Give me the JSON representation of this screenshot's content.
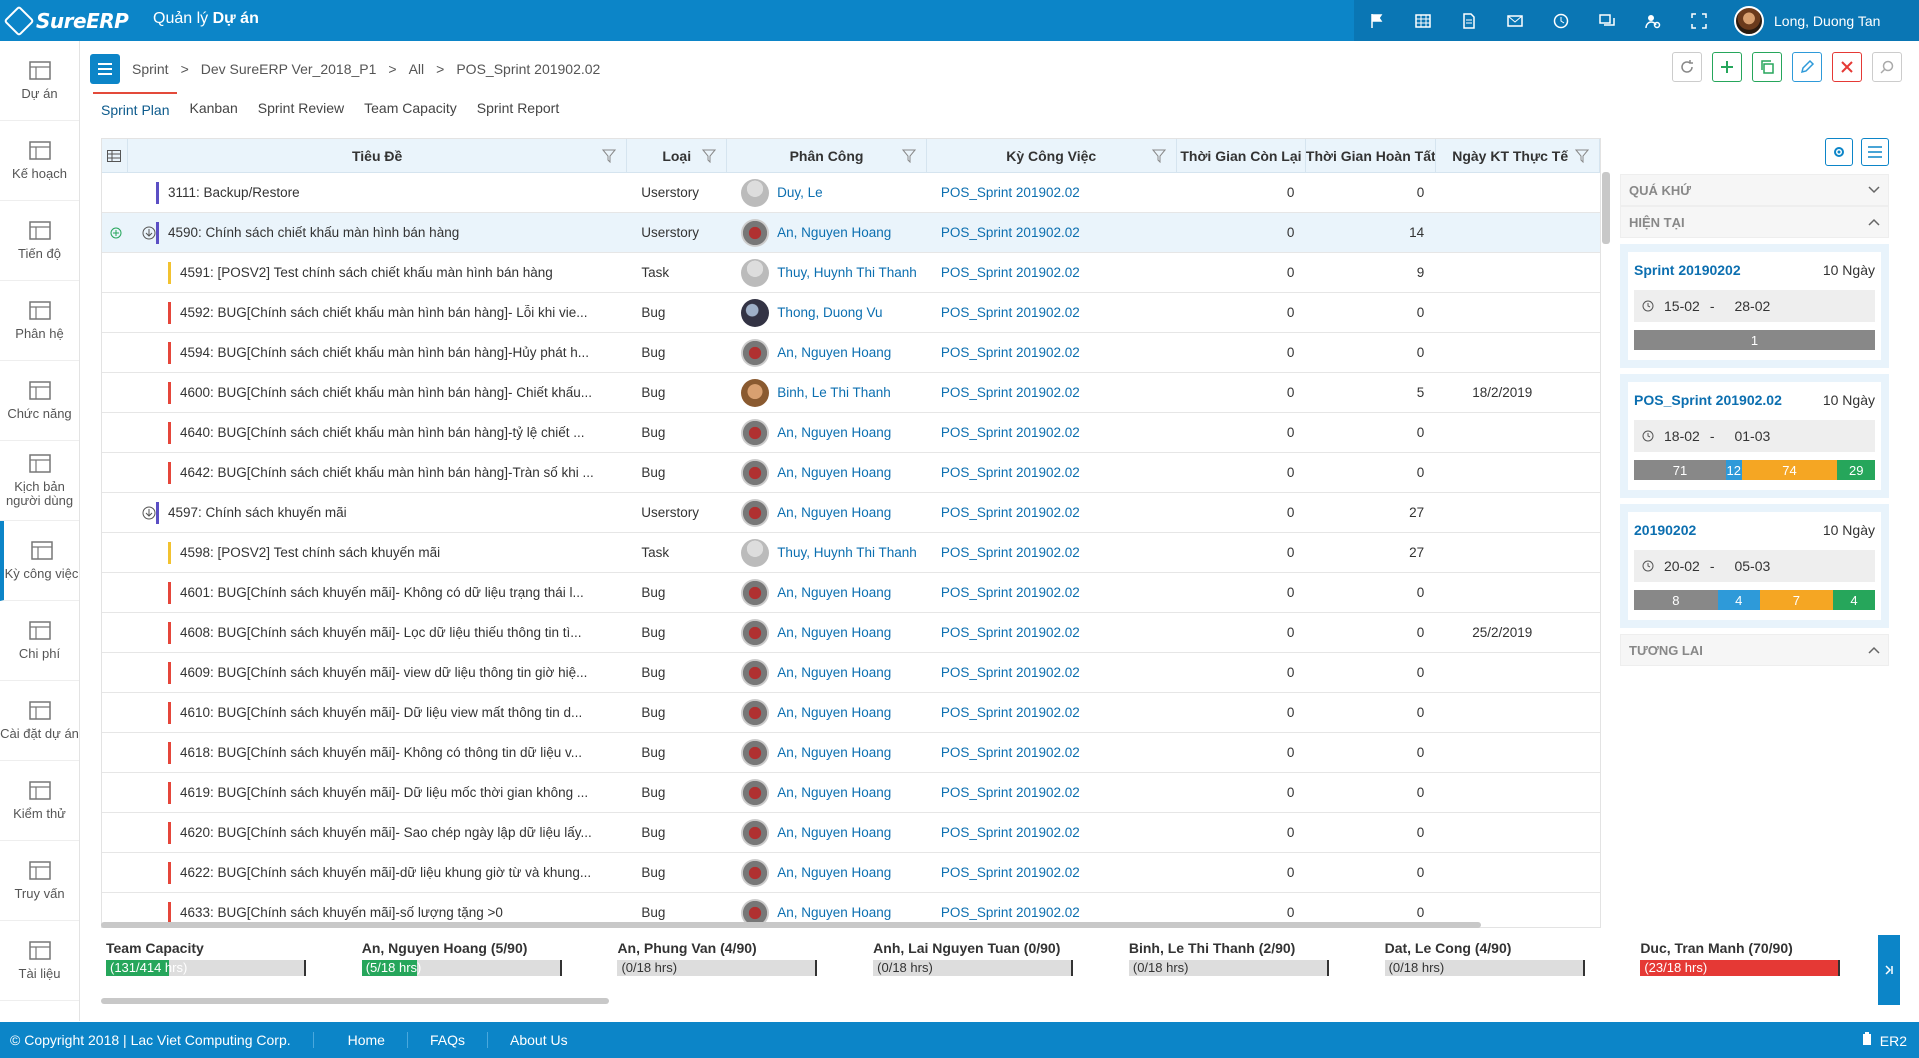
{
  "app": {
    "logo": "SureERP",
    "module": "Quản lý",
    "module_bold": "Dự án"
  },
  "topbar": {
    "icons": [
      "flag-icon",
      "table-icon",
      "document-icon",
      "mail-icon",
      "clock-icon",
      "chat-icon",
      "settings-person-icon",
      "fullscreen-icon"
    ],
    "user_name": "Long, Duong Tan"
  },
  "sidebar": {
    "items": [
      {
        "label": "Dự án",
        "icon": "project-icon"
      },
      {
        "label": "Kế hoạch",
        "icon": "plan-icon"
      },
      {
        "label": "Tiến độ",
        "icon": "progress-icon"
      },
      {
        "label": "Phân hệ",
        "icon": "module-icon"
      },
      {
        "label": "Chức năng",
        "icon": "function-icon"
      },
      {
        "label": "Kịch bản người dùng",
        "icon": "scenario-icon"
      },
      {
        "label": "Kỳ công việc",
        "icon": "sprint-icon",
        "active": true
      },
      {
        "label": "Chi phí",
        "icon": "cost-icon"
      },
      {
        "label": "Cài đặt dự án",
        "icon": "project-settings-icon"
      },
      {
        "label": "Kiểm thử",
        "icon": "test-icon"
      },
      {
        "label": "Truy vấn",
        "icon": "query-icon"
      },
      {
        "label": "Tài liệu",
        "icon": "docs-icon"
      }
    ]
  },
  "breadcrumb": {
    "items": [
      "Sprint",
      "Dev SureERP Ver_2018_P1",
      "All",
      "POS_Sprint 201902.02"
    ],
    "sep": ">"
  },
  "tabs": [
    "Sprint Plan",
    "Kanban",
    "Sprint Review",
    "Team Capacity",
    "Sprint Report"
  ],
  "grid": {
    "headers": {
      "title": "Tiêu Đề",
      "type": "Loại",
      "assignee": "Phân Công",
      "sprint": "Kỳ Công Việc",
      "remaining": "Thời Gian Còn Lại",
      "done": "Thời Gian Hoàn Tất",
      "end_date": "Ngày KT Thực Tế"
    },
    "rows": [
      {
        "title": "3111: Backup/Restore",
        "type": "Userstory",
        "assignee": "Duy, Le",
        "sprint": "POS_Sprint 201902.02",
        "remaining": "0",
        "done": "0",
        "end_date": "",
        "level": 0,
        "color": "#5b4fc4",
        "av": "grey"
      },
      {
        "title": "4590: Chính sách chiết khấu màn hình bán hàng",
        "type": "Userstory",
        "assignee": "An, Nguyen Hoang",
        "sprint": "POS_Sprint 201902.02",
        "remaining": "0",
        "done": "14",
        "end_date": "",
        "level": 0,
        "color": "#5b4fc4",
        "av": "logo",
        "expand": true,
        "selected": true
      },
      {
        "title": "4591: [POSV2] Test chính sách chiết khấu màn hình bán hàng",
        "type": "Task",
        "assignee": "Thuy, Huynh Thi Thanh",
        "sprint": "POS_Sprint 201902.02",
        "remaining": "0",
        "done": "9",
        "end_date": "",
        "level": 1,
        "color": "#f2c230",
        "av": "grey"
      },
      {
        "title": "4592: BUG[Chính sách chiết khấu màn hình bán hàng]- Lỗi khi vie...",
        "type": "Bug",
        "assignee": "Thong, Duong Vu",
        "sprint": "POS_Sprint 201902.02",
        "remaining": "0",
        "done": "0",
        "end_date": "",
        "level": 1,
        "color": "#e5463a",
        "av": "dark"
      },
      {
        "title": "4594: BUG[Chính sách chiết khấu màn hình bán hàng]-Hủy phát h...",
        "type": "Bug",
        "assignee": "An, Nguyen Hoang",
        "sprint": "POS_Sprint 201902.02",
        "remaining": "0",
        "done": "0",
        "end_date": "",
        "level": 1,
        "color": "#e5463a",
        "av": "logo"
      },
      {
        "title": "4600: BUG[Chính sách chiết khấu màn hình bán hàng]- Chiết khấu...",
        "type": "Bug",
        "assignee": "Binh, Le Thi Thanh",
        "sprint": "POS_Sprint 201902.02",
        "remaining": "0",
        "done": "5",
        "end_date": "18/2/2019",
        "level": 1,
        "color": "#e5463a",
        "av": "cat"
      },
      {
        "title": "4640: BUG[Chính sách chiết khấu màn hình bán hàng]-tỷ lệ chiết ...",
        "type": "Bug",
        "assignee": "An, Nguyen Hoang",
        "sprint": "POS_Sprint 201902.02",
        "remaining": "0",
        "done": "0",
        "end_date": "",
        "level": 1,
        "color": "#e5463a",
        "av": "logo"
      },
      {
        "title": "4642: BUG[Chính sách chiết khấu màn hình bán hàng]-Tràn số khi ...",
        "type": "Bug",
        "assignee": "An, Nguyen Hoang",
        "sprint": "POS_Sprint 201902.02",
        "remaining": "0",
        "done": "0",
        "end_date": "",
        "level": 1,
        "color": "#e5463a",
        "av": "logo"
      },
      {
        "title": "4597: Chính sách khuyến mãi",
        "type": "Userstory",
        "assignee": "An, Nguyen Hoang",
        "sprint": "POS_Sprint 201902.02",
        "remaining": "0",
        "done": "27",
        "end_date": "",
        "level": 0,
        "color": "#5b4fc4",
        "av": "logo",
        "expand": true
      },
      {
        "title": "4598: [POSV2] Test chính sách khuyến mãi",
        "type": "Task",
        "assignee": "Thuy, Huynh Thi Thanh",
        "sprint": "POS_Sprint 201902.02",
        "remaining": "0",
        "done": "27",
        "end_date": "",
        "level": 1,
        "color": "#f2c230",
        "av": "grey"
      },
      {
        "title": "4601: BUG[Chính sách khuyến mãi]- Không có dữ liệu trạng thái l...",
        "type": "Bug",
        "assignee": "An, Nguyen Hoang",
        "sprint": "POS_Sprint 201902.02",
        "remaining": "0",
        "done": "0",
        "end_date": "",
        "level": 1,
        "color": "#e5463a",
        "av": "logo"
      },
      {
        "title": "4608: BUG[Chính sách khuyến mãi]- Lọc dữ liệu thiếu thông tin tì...",
        "type": "Bug",
        "assignee": "An, Nguyen Hoang",
        "sprint": "POS_Sprint 201902.02",
        "remaining": "0",
        "done": "0",
        "end_date": "25/2/2019",
        "level": 1,
        "color": "#e5463a",
        "av": "logo"
      },
      {
        "title": "4609: BUG[Chính sách khuyến mãi]- view dữ liệu thông tin giờ hiệ...",
        "type": "Bug",
        "assignee": "An, Nguyen Hoang",
        "sprint": "POS_Sprint 201902.02",
        "remaining": "0",
        "done": "0",
        "end_date": "",
        "level": 1,
        "color": "#e5463a",
        "av": "logo"
      },
      {
        "title": "4610: BUG[Chính sách khuyến mãi]- Dữ liệu view mất thông tin d...",
        "type": "Bug",
        "assignee": "An, Nguyen Hoang",
        "sprint": "POS_Sprint 201902.02",
        "remaining": "0",
        "done": "0",
        "end_date": "",
        "level": 1,
        "color": "#e5463a",
        "av": "logo"
      },
      {
        "title": "4618: BUG[Chính sách khuyến mãi]- Không có thông tin dữ liệu v...",
        "type": "Bug",
        "assignee": "An, Nguyen Hoang",
        "sprint": "POS_Sprint 201902.02",
        "remaining": "0",
        "done": "0",
        "end_date": "",
        "level": 1,
        "color": "#e5463a",
        "av": "logo"
      },
      {
        "title": "4619: BUG[Chính sách khuyến mãi]- Dữ liệu mốc thời gian không ...",
        "type": "Bug",
        "assignee": "An, Nguyen Hoang",
        "sprint": "POS_Sprint 201902.02",
        "remaining": "0",
        "done": "0",
        "end_date": "",
        "level": 1,
        "color": "#e5463a",
        "av": "logo"
      },
      {
        "title": "4620: BUG[Chính sách khuyến mãi]- Sao chép ngày lập dữ liệu lấy...",
        "type": "Bug",
        "assignee": "An, Nguyen Hoang",
        "sprint": "POS_Sprint 201902.02",
        "remaining": "0",
        "done": "0",
        "end_date": "",
        "level": 1,
        "color": "#e5463a",
        "av": "logo"
      },
      {
        "title": "4622: BUG[Chính sách khuyến mãi]-dữ liệu khung giờ từ và khung...",
        "type": "Bug",
        "assignee": "An, Nguyen Hoang",
        "sprint": "POS_Sprint 201902.02",
        "remaining": "0",
        "done": "0",
        "end_date": "",
        "level": 1,
        "color": "#e5463a",
        "av": "logo"
      },
      {
        "title": "4633: BUG[Chính sách khuyến mãi]-số lượng tặng >0",
        "type": "Bug",
        "assignee": "An, Nguyen Hoang",
        "sprint": "POS_Sprint 201902.02",
        "remaining": "0",
        "done": "0",
        "end_date": "",
        "level": 1,
        "color": "#e5463a",
        "av": "logo"
      }
    ]
  },
  "right_panel": {
    "past": "QUÁ KHỨ",
    "present": "HIỆN TẠI",
    "future": "TƯƠNG LAI",
    "sprints": [
      {
        "name": "Sprint 20190202",
        "days": "10 Ngày",
        "start": "15-02",
        "end": "28-02",
        "segments": [
          {
            "v": "1",
            "c": "#888888",
            "w": 1
          }
        ]
      },
      {
        "name": "POS_Sprint 201902.02",
        "days": "10 Ngày",
        "start": "18-02",
        "end": "01-03",
        "segments": [
          {
            "v": "71",
            "c": "#888888",
            "w": 71
          },
          {
            "v": "12",
            "c": "#2e9ad9",
            "w": 12
          },
          {
            "v": "74",
            "c": "#f5a623",
            "w": 74
          },
          {
            "v": "29",
            "c": "#26a65b",
            "w": 29
          }
        ]
      },
      {
        "name": "20190202",
        "days": "10 Ngày",
        "start": "20-02",
        "end": "05-03",
        "segments": [
          {
            "v": "8",
            "c": "#888888",
            "w": 8
          },
          {
            "v": "4",
            "c": "#2e9ad9",
            "w": 4
          },
          {
            "v": "7",
            "c": "#f5a623",
            "w": 7
          },
          {
            "v": "4",
            "c": "#26a65b",
            "w": 4
          }
        ]
      }
    ]
  },
  "capacity": [
    {
      "name": "Team Capacity",
      "text": "(131/414 hrs)",
      "fill": 0.32,
      "color": "#26a65b"
    },
    {
      "name": "An, Nguyen Hoang (5/90)",
      "text": "(5/18 hrs)",
      "fill": 0.28,
      "color": "#26a65b"
    },
    {
      "name": "An, Phung Van (4/90)",
      "text": "(0/18 hrs)",
      "fill": 0,
      "color": "#26a65b"
    },
    {
      "name": "Anh, Lai Nguyen Tuan (0/90)",
      "text": "(0/18 hrs)",
      "fill": 0,
      "color": "#26a65b"
    },
    {
      "name": "Binh, Le Thi Thanh (2/90)",
      "text": "(0/18 hrs)",
      "fill": 0,
      "color": "#26a65b"
    },
    {
      "name": "Dat, Le Cong (4/90)",
      "text": "(0/18 hrs)",
      "fill": 0,
      "color": "#26a65b"
    },
    {
      "name": "Duc, Tran Manh (70/90)",
      "text": "(23/18 hrs)",
      "fill": 1,
      "color": "#e53935"
    }
  ],
  "footer": {
    "copyright": "© Copyright 2018 | Lac Viet Computing Corp.",
    "links": [
      "Home",
      "FAQs",
      "About Us"
    ],
    "right": "ER2"
  }
}
